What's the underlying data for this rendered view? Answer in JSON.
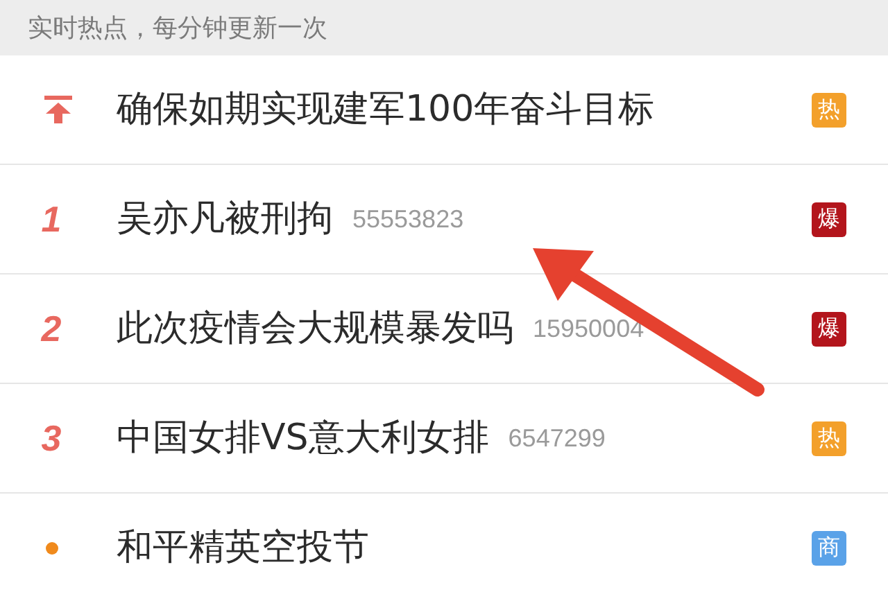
{
  "header": {
    "text": "实时热点，每分钟更新一次"
  },
  "items": [
    {
      "kind": "pinned",
      "title": "确保如期实现建军100年奋斗目标",
      "badge": {
        "text": "热",
        "color": "#f3a02b"
      }
    },
    {
      "kind": "ranked",
      "rank": "1",
      "title": "吴亦凡被刑拘",
      "count": "55553823",
      "badge": {
        "text": "爆",
        "color": "#b3151c"
      }
    },
    {
      "kind": "ranked",
      "rank": "2",
      "title": "此次疫情会大规模暴发吗",
      "count": "15950004",
      "badge": {
        "text": "爆",
        "color": "#b3151c"
      }
    },
    {
      "kind": "ranked",
      "rank": "3",
      "title": "中国女排VS意大利女排",
      "count": "6547299",
      "badge": {
        "text": "热",
        "color": "#f3a02b"
      }
    },
    {
      "kind": "promoted",
      "title": "和平精英空投节",
      "badge": {
        "text": "商",
        "color": "#5aa2e8"
      }
    }
  ]
}
